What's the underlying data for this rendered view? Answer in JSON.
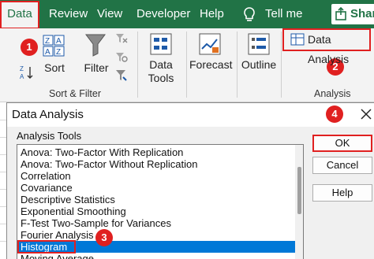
{
  "ribbon_tabs": [
    "Data",
    "Review",
    "View",
    "Developer",
    "Help",
    "Tell me"
  ],
  "share_label": "Share",
  "groups": {
    "sort_filter": {
      "sort_label": "Sort",
      "filter_label": "Filter",
      "group_label": "Sort & Filter"
    },
    "data_tools_label_1": "Data",
    "data_tools_label_2": "Tools",
    "forecast_label": "Forecast",
    "outline_label": "Outline",
    "analysis": {
      "button_label": "Data Analysis",
      "group_label": "Analysis"
    }
  },
  "badges": [
    "1",
    "2",
    "3",
    "4"
  ],
  "dialog": {
    "title": "Data Analysis",
    "tools_label": "Analysis Tools",
    "items": [
      "Anova: Two-Factor With Replication",
      "Anova: Two-Factor Without Replication",
      "Correlation",
      "Covariance",
      "Descriptive Statistics",
      "Exponential Smoothing",
      "F-Test Two-Sample for Variances",
      "Fourier Analysis",
      "Histogram",
      "Moving Average"
    ],
    "selected_item": "Histogram",
    "buttons": {
      "ok": "OK",
      "cancel": "Cancel",
      "help": "Help"
    }
  },
  "colors": {
    "ribbon": "#217346",
    "highlight": "#e02020",
    "selection": "#0078d7"
  },
  "icons": [
    "tellme-lightbulb-icon",
    "share-icon",
    "sort-az-icon",
    "sort-za-icon",
    "sort-icon",
    "filter-icon",
    "clear-filter-icon",
    "reapply-icon",
    "advanced-filter-icon",
    "data-tools-icon",
    "forecast-icon",
    "outline-icon",
    "data-analysis-icon",
    "close-icon"
  ]
}
